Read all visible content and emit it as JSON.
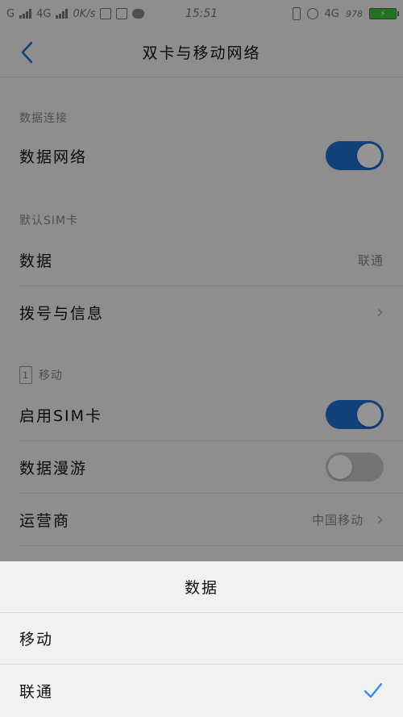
{
  "status_bar": {
    "left_text_1": "G",
    "left_text_2": "4G",
    "speed": "0K/s",
    "time": "15:51",
    "net_right": "4G",
    "sim_right": "978"
  },
  "header": {
    "title": "双卡与移动网络"
  },
  "sections": {
    "data_connection": {
      "label": "数据连接",
      "rows": {
        "data_network": {
          "label": "数据网络",
          "toggle": "on"
        }
      }
    },
    "default_sim": {
      "label": "默认SIM卡",
      "rows": {
        "data": {
          "label": "数据",
          "value": "联通"
        },
        "dial_sms": {
          "label": "拨号与信息"
        }
      }
    },
    "mobile": {
      "label": "移动",
      "sim_number": "1",
      "rows": {
        "enable_sim": {
          "label": "启用SIM卡",
          "toggle": "on"
        },
        "roaming": {
          "label": "数据漫游",
          "toggle": "off"
        },
        "carrier": {
          "label": "运营商",
          "value": "中国移动"
        }
      }
    }
  },
  "sheet": {
    "title": "数据",
    "options": [
      {
        "label": "移动",
        "selected": false
      },
      {
        "label": "联通",
        "selected": true
      }
    ]
  },
  "colors": {
    "accent": "#1f6fd0",
    "toggle_off": "#c9c9c9",
    "check": "#3a8ee6"
  }
}
